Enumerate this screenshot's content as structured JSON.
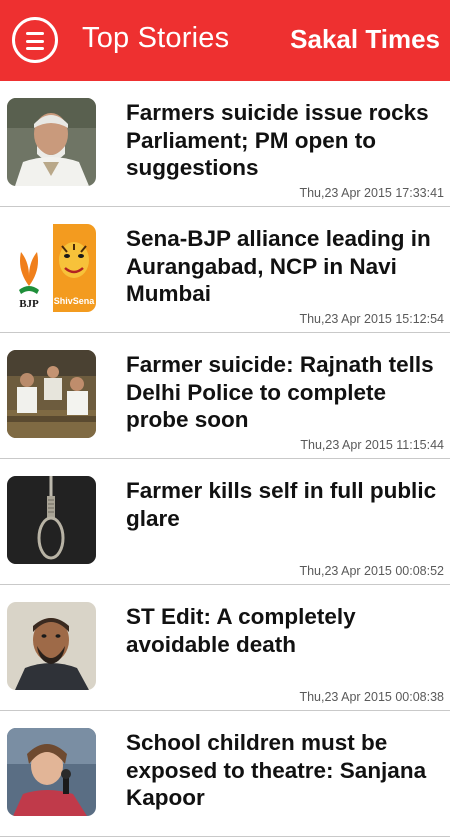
{
  "appbar": {
    "title": "Top Stories",
    "brand": "Sakal Times",
    "background_color": "#ee3030",
    "menu_icon": "menu-icon"
  },
  "stories": [
    {
      "headline": "Farmers suicide issue rocks Parliament; PM open to suggestions",
      "timestamp": "Thu,23 Apr 2015 17:33:41",
      "thumbnail": "politician-photo"
    },
    {
      "headline": "Sena-BJP alliance leading in Aurangabad, NCP in Navi Mumbai",
      "timestamp": "Thu,23 Apr 2015 15:12:54",
      "thumbnail": "bjp-shivsena-logos",
      "thumb_labels": [
        "BJP",
        "ShivSena"
      ]
    },
    {
      "headline": "Farmer suicide: Rajnath tells Delhi Police to complete probe soon",
      "timestamp": "Thu,23 Apr 2015 11:15:44",
      "thumbnail": "parliament-photo"
    },
    {
      "headline": "Farmer kills self in full public glare",
      "timestamp": "Thu,23 Apr 2015 00:08:52",
      "thumbnail": "noose-photo"
    },
    {
      "headline": "ST Edit: A completely avoidable death",
      "timestamp": "Thu,23 Apr 2015 00:08:38",
      "thumbnail": "man-portrait-photo"
    },
    {
      "headline": "School children must be exposed to theatre: Sanjana Kapoor",
      "timestamp": "",
      "thumbnail": "woman-speaking-photo"
    }
  ]
}
